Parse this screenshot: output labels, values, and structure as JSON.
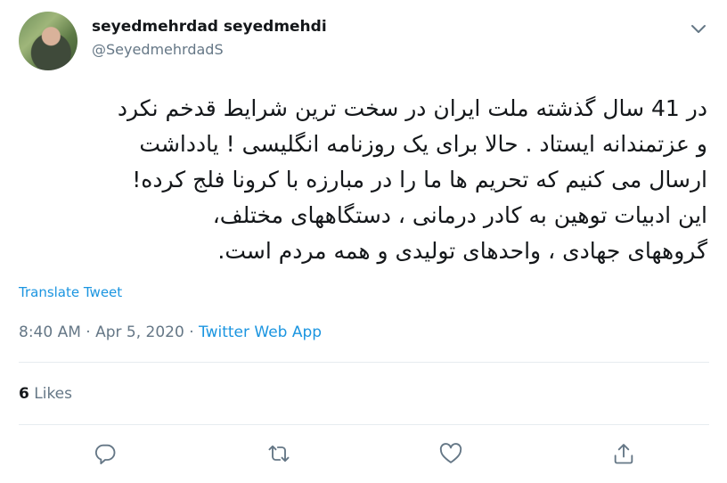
{
  "author": {
    "display_name": "seyedmehrdad seyedmehdi",
    "handle": "@SeyedmehrdadS"
  },
  "tweet": {
    "lines": [
      "در 41 سال گذشته ملت ایران در سخت ترین شرایط قدخم نکرد",
      "و عزتمندانه ایستاد . حالا برای یک روزنامه انگلیسی ! یادداشت",
      "ارسال می کنیم  که تحریم ها ما را در مبارزه با کرونا فلج کرده!",
      "این ادبیات توهین به کادر درمانی ، دستگاههای مختلف،",
      "گروههای جهادی ، واحدهای تولیدی و همه مردم است."
    ],
    "translate_label": "Translate Tweet",
    "time": "8:40 AM",
    "separator": "·",
    "date": "Apr 5, 2020",
    "source": "Twitter Web App"
  },
  "stats": {
    "likes_count": "6",
    "likes_label": "Likes"
  },
  "icons": {
    "more": "chevron-down-icon",
    "reply": "reply-icon",
    "retweet": "retweet-icon",
    "like": "heart-icon",
    "share": "share-icon"
  },
  "colors": {
    "link": "#1b95e0",
    "muted": "#657786",
    "text": "#14171a",
    "divider": "#e6ecf0"
  }
}
